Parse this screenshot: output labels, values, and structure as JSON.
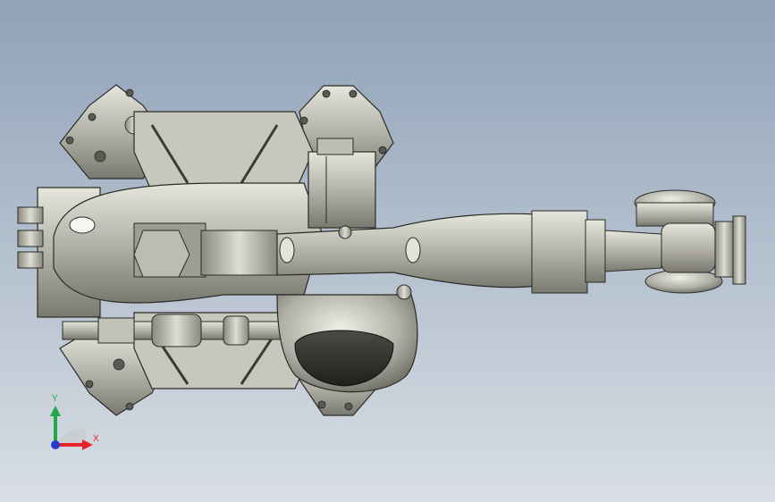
{
  "viewport": {
    "background_top": "#8fa2b8",
    "background_bottom": "#d8dee4"
  },
  "model": {
    "metal_light": "#d4d3ca",
    "metal_mid": "#a9a89e",
    "metal_dark": "#6f6e66",
    "edge_color": "#2b2b28"
  },
  "triad": {
    "y_label": "Y",
    "x_label": "X",
    "y_color": "#22a84a",
    "x_color": "#e8232b",
    "z_color": "#2a3ad0"
  }
}
